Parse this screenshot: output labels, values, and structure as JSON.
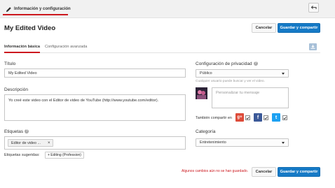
{
  "topbar": {
    "tab_label": "Información y configuración",
    "back_icon": "undo-arrow-icon"
  },
  "header": {
    "title": "My Edited Video",
    "cancel_label": "Cancelar",
    "save_label": "Guardar y compartir"
  },
  "tabs": [
    {
      "label": "Información básica",
      "active": true
    },
    {
      "label": "Configuración avanzada",
      "active": false
    }
  ],
  "basic": {
    "title_label": "Título",
    "title_value": "My Edited Video",
    "description_label": "Descripción",
    "description_value": "Yo creé este video con el Editor de video de YouTube (http://www.youtube.com/editor).",
    "tags_label": "Etiquetas",
    "tag_chip": "Editor de video ...",
    "tag_remove": "×",
    "suggested_label": "Etiquetas sugeridas:",
    "suggested_chip": "+ Editing (Profession)"
  },
  "privacy": {
    "label": "Configuración de privacidad",
    "selected": "Público",
    "hint": "Cualquier usuario puede buscar y ver el video.",
    "message_placeholder": "Personalizar tu mensaje",
    "share_label": "También compartir en",
    "networks": [
      {
        "name": "google-plus-icon",
        "glyph": "g+",
        "color": "#dd4b39"
      },
      {
        "name": "facebook-icon",
        "glyph": "f",
        "color": "#3b5998"
      },
      {
        "name": "twitter-icon",
        "glyph": "t",
        "color": "#1da1f2"
      }
    ]
  },
  "category": {
    "label": "Categoría",
    "selected": "Entretenimiento"
  },
  "footer": {
    "unsaved_text": "Algunos cambios aún no se han guardado.",
    "cancel_label": "Cancelar",
    "save_label": "Guardar y compartir"
  },
  "colors": {
    "accent_red": "#cc181e",
    "primary_blue": "#167ac6",
    "warning_red": "#cc181e"
  }
}
